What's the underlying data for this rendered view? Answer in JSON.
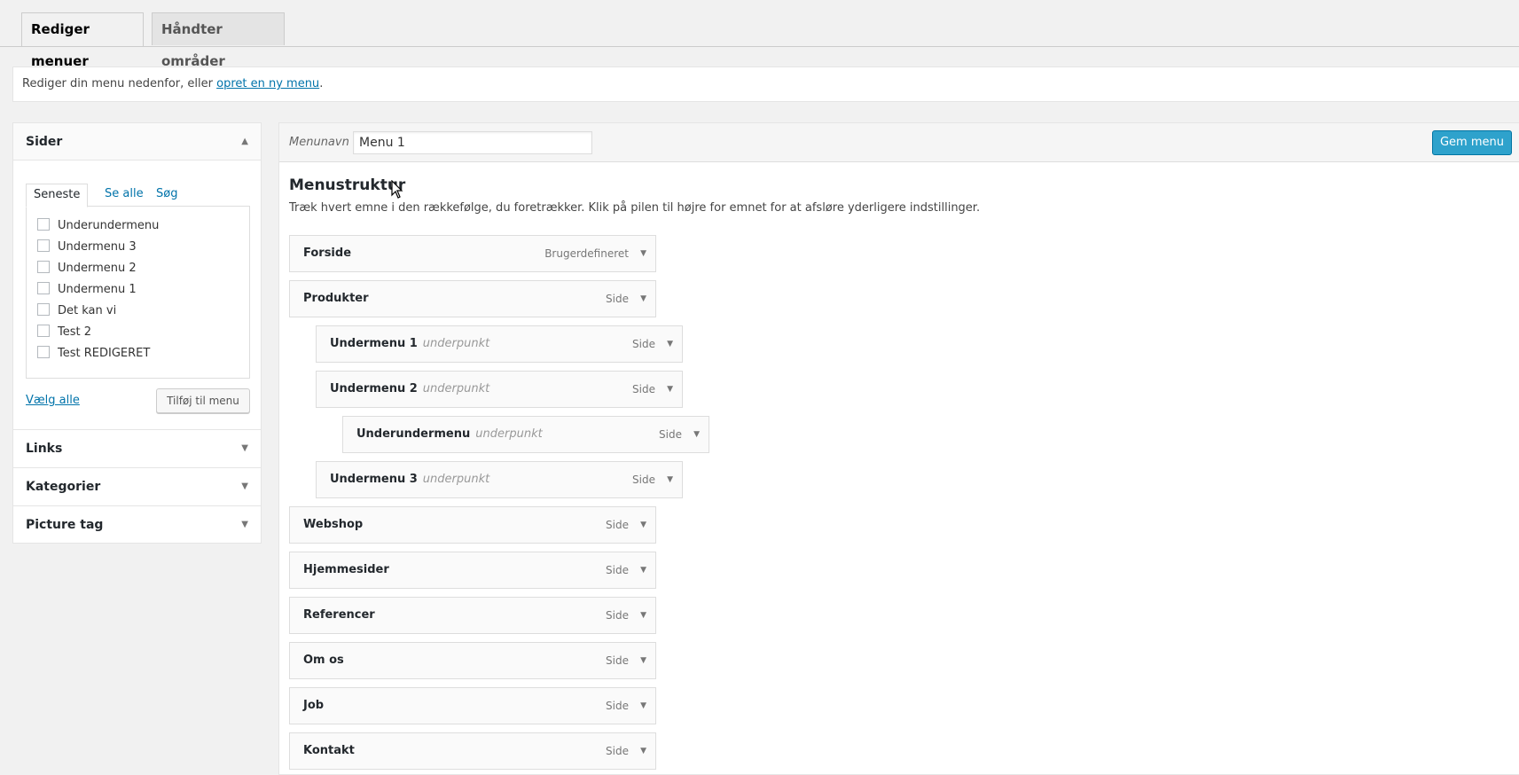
{
  "tabs": {
    "edit_menus": "Rediger menuer",
    "manage_locations": "Håndter områder"
  },
  "notice": {
    "text_before": "Rediger din menu nedenfor, eller ",
    "link": "opret en ny menu",
    "text_after": "."
  },
  "sidebar": {
    "pages": {
      "title": "Sider",
      "tabs": [
        "Seneste",
        "Se alle",
        "Søg"
      ],
      "items": [
        "Underundermenu",
        "Undermenu 3",
        "Undermenu 2",
        "Undermenu 1",
        "Det kan vi",
        "Test 2",
        "Test REDIGERET"
      ],
      "select_all": "Vælg alle",
      "add_button": "Tilføj til menu"
    },
    "links_title": "Links",
    "categories_title": "Kategorier",
    "picture_tag_title": "Picture tag"
  },
  "main": {
    "menu_name_label": "Menunavn",
    "menu_name_value": "Menu 1",
    "save_button": "Gem menu",
    "structure_title": "Menustruktur",
    "structure_desc": "Træk hvert emne i den rækkefølge, du foretrækker. Klik på pilen til højre for emnet for at afsløre yderligere indstillinger.",
    "items": [
      {
        "title": "Forside",
        "sub": "",
        "type": "Brugerdefineret",
        "depth": 0
      },
      {
        "title": "Produkter",
        "sub": "",
        "type": "Side",
        "depth": 0
      },
      {
        "title": "Undermenu 1",
        "sub": "underpunkt",
        "type": "Side",
        "depth": 1
      },
      {
        "title": "Undermenu 2",
        "sub": "underpunkt",
        "type": "Side",
        "depth": 1
      },
      {
        "title": "Underundermenu",
        "sub": "underpunkt",
        "type": "Side",
        "depth": 2
      },
      {
        "title": "Undermenu 3",
        "sub": "underpunkt",
        "type": "Side",
        "depth": 1
      },
      {
        "title": "Webshop",
        "sub": "",
        "type": "Side",
        "depth": 0
      },
      {
        "title": "Hjemmesider",
        "sub": "",
        "type": "Side",
        "depth": 0
      },
      {
        "title": "Referencer",
        "sub": "",
        "type": "Side",
        "depth": 0
      },
      {
        "title": "Om os",
        "sub": "",
        "type": "Side",
        "depth": 0
      },
      {
        "title": "Job",
        "sub": "",
        "type": "Side",
        "depth": 0
      },
      {
        "title": "Kontakt",
        "sub": "",
        "type": "Side",
        "depth": 0
      }
    ]
  },
  "icons": {
    "collapse": "triangle-up-icon",
    "expand": "triangle-down-icon",
    "item_toggle": "caret-down-icon"
  }
}
